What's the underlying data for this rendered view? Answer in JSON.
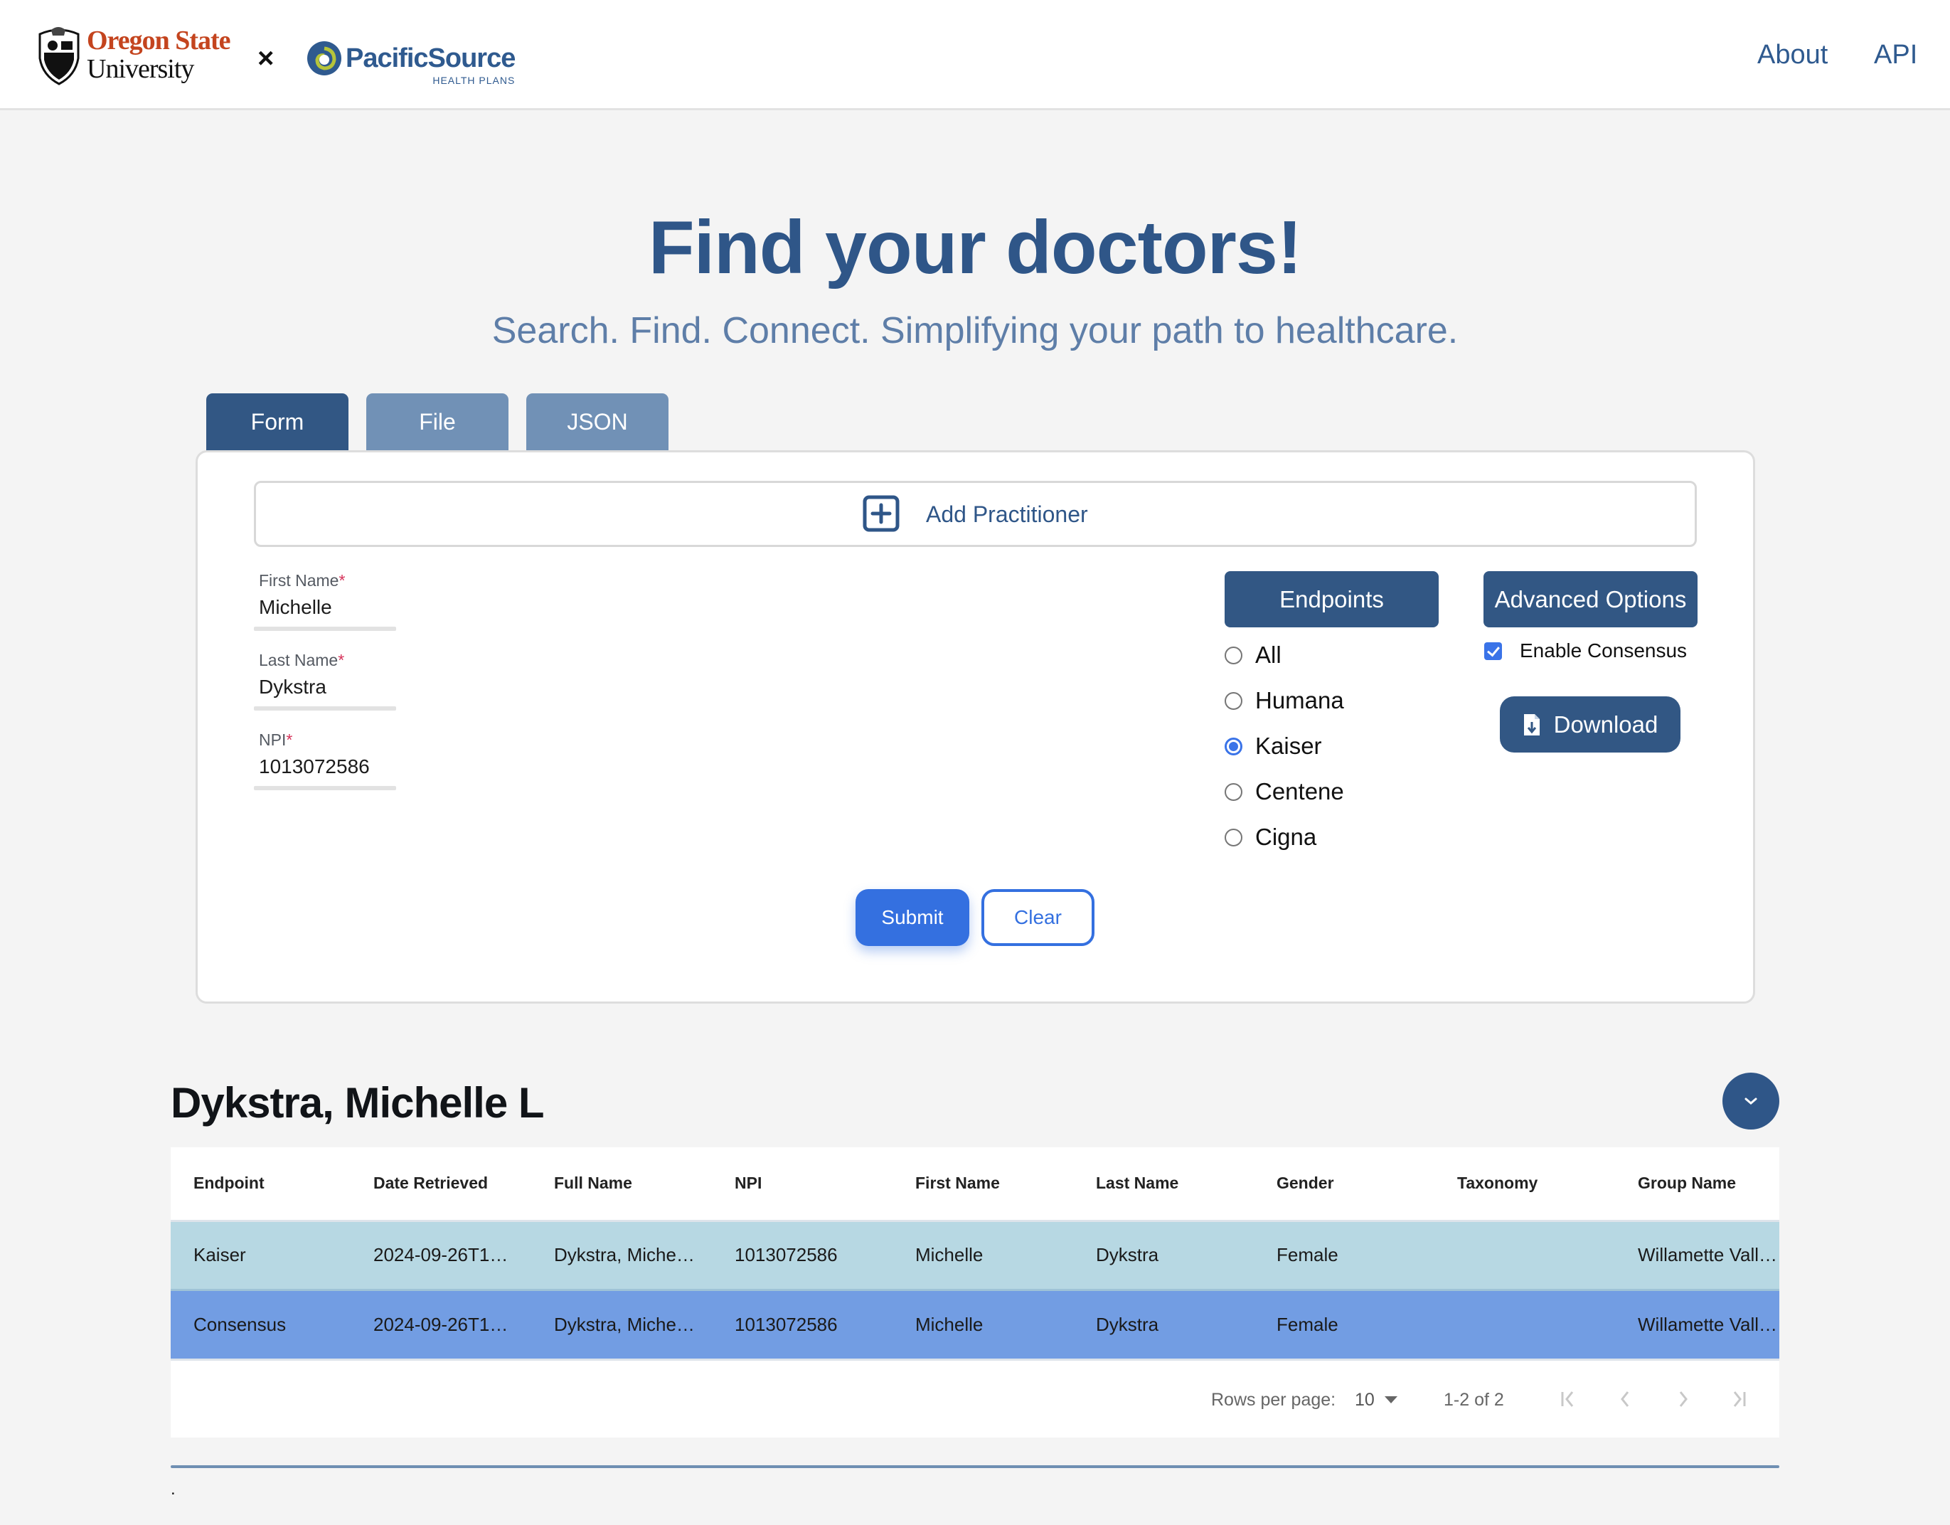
{
  "header": {
    "logo_osu_line1": "Oregon State",
    "logo_osu_line2": "University",
    "separator": "×",
    "logo_ps_line1": "PacificSource",
    "logo_ps_line2": "HEALTH PLANS",
    "nav": [
      {
        "label": "About"
      },
      {
        "label": "API"
      }
    ]
  },
  "hero": {
    "title": "Find your doctors!",
    "subtitle": "Search. Find. Connect. Simplifying your path to healthcare."
  },
  "tabs": [
    {
      "label": "Form",
      "active": true
    },
    {
      "label": "File",
      "active": false
    },
    {
      "label": "JSON",
      "active": false
    }
  ],
  "form": {
    "add_practitioner_label": "Add Practitioner",
    "fields": [
      {
        "label": "First Name",
        "required_mark": "*",
        "value": "Michelle"
      },
      {
        "label": "Last Name",
        "required_mark": "*",
        "value": "Dykstra"
      },
      {
        "label": "NPI",
        "required_mark": "*",
        "value": "1013072586"
      }
    ],
    "endpoints_label": "Endpoints",
    "endpoints": [
      {
        "label": "All",
        "checked": false
      },
      {
        "label": "Humana",
        "checked": false
      },
      {
        "label": "Kaiser",
        "checked": true
      },
      {
        "label": "Centene",
        "checked": false
      },
      {
        "label": "Cigna",
        "checked": false
      }
    ],
    "advanced_options_label": "Advanced Options",
    "enable_consensus_label": "Enable Consensus",
    "enable_consensus_checked": true,
    "download_label": "Download",
    "submit_label": "Submit",
    "clear_label": "Clear"
  },
  "results": {
    "heading": "Dykstra, Michelle L",
    "columns": [
      "Endpoint",
      "Date Retrieved",
      "Full Name",
      "NPI",
      "First Name",
      "Last Name",
      "Gender",
      "Taxonomy",
      "Group Name"
    ],
    "rows": [
      [
        "Kaiser",
        "2024-09-26T1…",
        "Dykstra, Miche…",
        "1013072586",
        "Michelle",
        "Dykstra",
        "Female",
        "",
        "Willamette Vall…"
      ],
      [
        "Consensus",
        "2024-09-26T1…",
        "Dykstra, Miche…",
        "1013072586",
        "Michelle",
        "Dykstra",
        "Female",
        "",
        "Willamette Vall…"
      ]
    ],
    "pagination": {
      "rows_per_page_label": "Rows per page:",
      "rows_per_page_value": "10",
      "range_text": "1-2 of 2"
    }
  },
  "footer": {
    "text": "."
  },
  "colors": {
    "brand_dark": "#325784",
    "brand_light": "#7191b6",
    "accent_blue": "#3470e0",
    "row_kaiser": "#b7d8e3",
    "row_consensus": "#729de3",
    "osu_orange": "#c4441e"
  }
}
